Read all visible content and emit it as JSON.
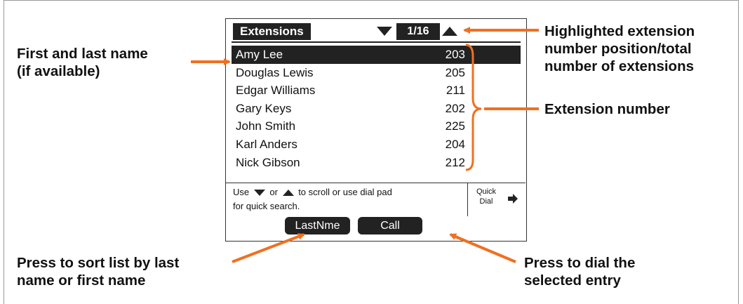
{
  "screen": {
    "title": "Extensions",
    "position": "1/16",
    "entries": [
      {
        "name": "Amy Lee",
        "ext": "203"
      },
      {
        "name": "Douglas Lewis",
        "ext": "205"
      },
      {
        "name": "Edgar Williams",
        "ext": "211"
      },
      {
        "name": "Gary Keys",
        "ext": "202"
      },
      {
        "name": "John Smith",
        "ext": "225"
      },
      {
        "name": "Karl Anders",
        "ext": "204"
      },
      {
        "name": "Nick Gibson",
        "ext": "212"
      }
    ],
    "selected_index": 0,
    "help_use": "Use",
    "help_or": "or",
    "help_rest1": "to scroll or use dial pad",
    "help_rest2": "for quick search.",
    "quick_dial_line1": "Quick",
    "quick_dial_line2": "Dial",
    "softkeys": {
      "left": "LastNme",
      "right": "Call"
    }
  },
  "annotations": {
    "name": [
      "First and last name",
      "(if available)"
    ],
    "position": [
      "Highlighted extension",
      "number position/total",
      "number of extensions"
    ],
    "extension": "Extension number",
    "sort": [
      "Press to sort list by last",
      "name or first name"
    ],
    "dial": [
      "Press to dial the",
      "selected entry"
    ]
  },
  "colors": {
    "accent": "#f07020",
    "display_dark": "#222222"
  }
}
